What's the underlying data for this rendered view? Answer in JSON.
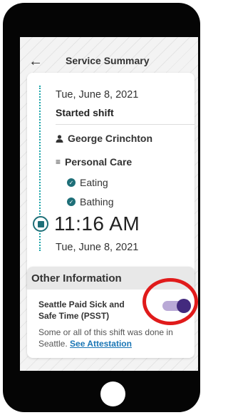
{
  "header": {
    "back_icon": "left-arrow-icon",
    "title": "Service Summary"
  },
  "summary": {
    "date_top": "Tue, June 8, 2021",
    "event": "Started shift",
    "caregiver": "George Crinchton",
    "task_category": "Personal Care",
    "tasks": [
      {
        "label": "Eating"
      },
      {
        "label": "Bathing"
      }
    ],
    "time": "11:16 AM",
    "date_bottom": "Tue, June 8, 2021"
  },
  "other_info": {
    "heading": "Other Information",
    "psst_label": "Seattle Paid Sick and Safe Time (PSST)",
    "psst_enabled": true,
    "description": "Some or all of this shift was done in Seattle.",
    "link_text": "See Attestation"
  },
  "colors": {
    "accent_teal": "#1e6f78",
    "toggle_purple": "#432a7e",
    "link_blue": "#1a76b5",
    "highlight_red": "#e01b1b"
  }
}
